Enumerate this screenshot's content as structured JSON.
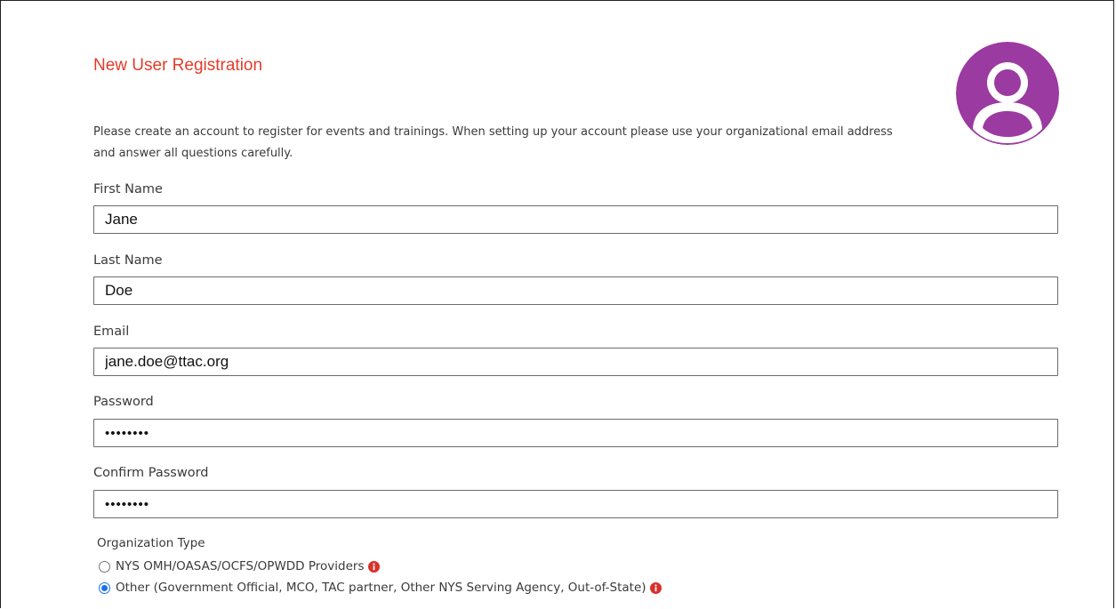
{
  "page": {
    "title": "New User Registration",
    "intro": "Please create an account to register for events and trainings. When setting up your account please use your organizational email address and answer all questions carefully."
  },
  "fields": {
    "first_name": {
      "label": "First Name",
      "value": "Jane"
    },
    "last_name": {
      "label": "Last Name",
      "value": "Doe"
    },
    "email": {
      "label": "Email",
      "value": "jane.doe@ttac.org"
    },
    "password": {
      "label": "Password",
      "value": "••••••••"
    },
    "confirm_password": {
      "label": "Confirm Password",
      "value": "••••••••"
    }
  },
  "organization_type": {
    "label": "Organization Type",
    "options": [
      {
        "label": "NYS OMH/OASAS/OCFS/OPWDD Providers",
        "selected": false
      },
      {
        "label": "Other (Government Official, MCO, TAC partner, Other NYS Serving Agency, Out-of-State)",
        "selected": true
      }
    ]
  },
  "icons": {
    "avatar": "user-avatar-icon",
    "info": "info-icon"
  },
  "colors": {
    "title": "#e23c2a",
    "avatar": "#9b3aa0",
    "info": "#d9302a",
    "radio_selected": "#1a73e8"
  }
}
